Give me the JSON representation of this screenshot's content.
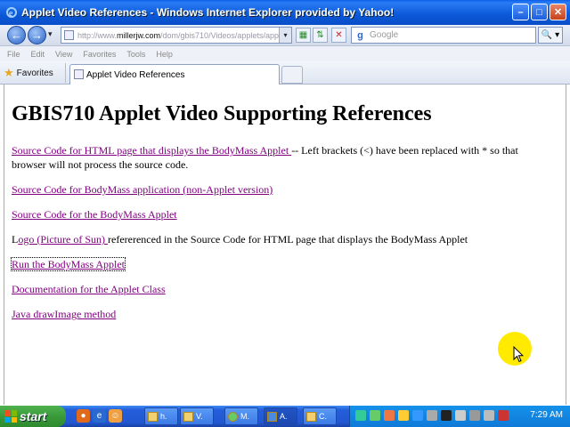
{
  "window": {
    "title": "Applet Video References - Windows Internet Explorer provided by Yahoo!",
    "minimize": "–",
    "maximize": "□",
    "close": "✕"
  },
  "navbar": {
    "back": "←",
    "forward": "→",
    "dropdown": "▾",
    "address_prefix": "http://www.",
    "address_domain": "millerjw.com",
    "address_rest": "/dom/gbis710/Videos/applets/app",
    "search_placeholder": "Google",
    "search_go": "🔍 ▾"
  },
  "menu": [
    "File",
    "Edit",
    "View",
    "Favorites",
    "Tools",
    "Help"
  ],
  "favbar": {
    "favorites_label": "Favorites",
    "tab_title": "Applet Video References"
  },
  "content": {
    "heading": "GBIS710 Applet Video Supporting References",
    "p1_link": "Source Code for HTML page that displays the BodyMass Applet ",
    "p1_text": "-- Left brackets (<) have been replaced with * so that browser will not process the source code.",
    "p2_link": "Source Code for BodyMass application (non-Applet version)",
    "p3_link": "Source Code for the BodyMass Applet",
    "p4_pre": "L",
    "p4_link": "ogo (Picture of Sun) ",
    "p4_text": "refererenced in the Source Code for HTML page that displays the BodyMass Applet",
    "p5_link": "Run the BodyMass Applet",
    "p6_link": "Documentation for the Applet Class",
    "p7_link": "Java drawImage method"
  },
  "taskbar": {
    "start": "start",
    "tasks": [
      "h.",
      "V.",
      "M.",
      "A.",
      "C."
    ],
    "clock": "7:29 AM"
  }
}
